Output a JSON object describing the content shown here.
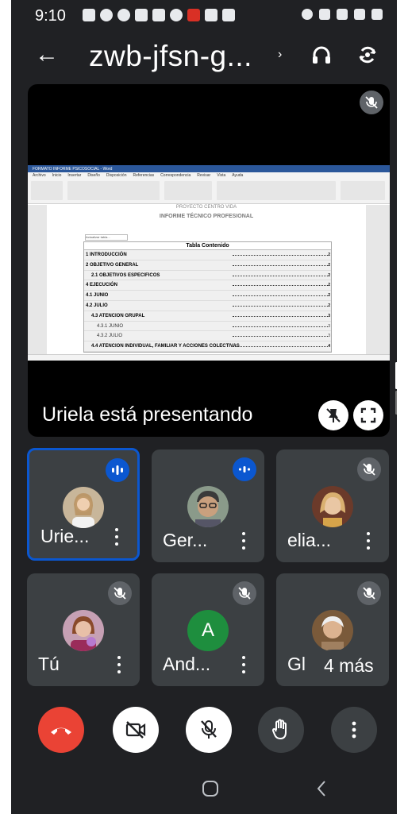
{
  "status_bar": {
    "time": "9:10"
  },
  "header": {
    "meeting_code": "zwb-jfsn-g...",
    "chevron": "›",
    "back_icon": "←"
  },
  "presentation": {
    "presenter_text": "Uriela está presentando",
    "document": {
      "ribbon_title": "FORMATO INFORME PSICOSOCIAL - Word",
      "tabs": [
        "Archivo",
        "Inicio",
        "Insertar",
        "Diseño",
        "Disposición",
        "Referencias",
        "Correspondencia",
        "Revisar",
        "Vista",
        "Ayuda"
      ],
      "header_text": "PROYECTO CENTRO VIDA",
      "subtitle": "INFORME TÉCNICO PROFESIONAL",
      "toc_button": "Actualizar tabla...",
      "toc_title": "Tabla Contenido",
      "toc_entries": [
        {
          "text": "1 INTRODUCCIÓN",
          "page": "2",
          "indent": 0
        },
        {
          "text": "2 OBJETIVO GENERAL",
          "page": "2",
          "indent": 0
        },
        {
          "text": "2.1 OBJETIVOS ESPECIFICOS",
          "page": "2",
          "indent": 1
        },
        {
          "text": "4 EJECUCIÓN",
          "page": "2",
          "indent": 0
        },
        {
          "text": "4.1 JUNIO",
          "page": "2",
          "indent": 0
        },
        {
          "text": "4.2 JULIO",
          "page": "2",
          "indent": 0
        },
        {
          "text": "4.3   ATENCION GRUPAL",
          "page": "3",
          "indent": 1
        },
        {
          "text": "4.3.1 JUNIO",
          "page": "3",
          "indent": 2
        },
        {
          "text": "4.3.2 JULIO",
          "page": "3",
          "indent": 2
        },
        {
          "text": "4.4 ATENCION INDIVIDUAL, FAMILIAR Y ACCIONES COLECTIVAS",
          "page": "4",
          "indent": 1
        }
      ]
    }
  },
  "participants": [
    {
      "name": "Urie...",
      "state": "speaking",
      "active": true
    },
    {
      "name": "Ger...",
      "state": "speaking",
      "active": false
    },
    {
      "name": "elia...",
      "state": "muted",
      "active": false
    },
    {
      "name": "Tú",
      "state": "muted",
      "active": false
    },
    {
      "name": "And...",
      "state": "muted",
      "active": false,
      "initial": "A"
    },
    {
      "name": "Gl",
      "state": "muted",
      "active": false
    }
  ],
  "more_participants": "4 más",
  "colors": {
    "background": "#202124",
    "tile": "#3c4043",
    "accent": "#0b57d0",
    "end_call": "#ea4335",
    "avatar_green": "#1e8e3e"
  },
  "icons": [
    "back-icon",
    "headphones-icon",
    "switch-camera-icon",
    "mic-off-icon",
    "pin-off-icon",
    "fullscreen-icon",
    "audio-wave-icon",
    "more-vert-icon",
    "end-call-icon",
    "camera-off-icon",
    "raise-hand-icon",
    "home-icon",
    "back-nav-icon"
  ]
}
